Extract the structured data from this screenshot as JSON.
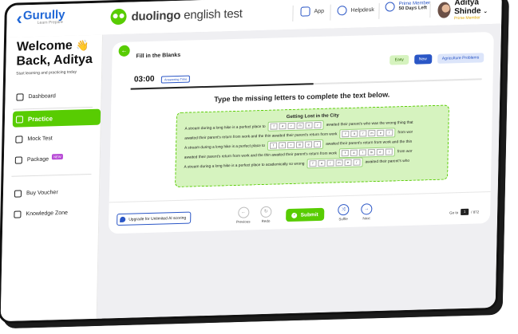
{
  "brand": {
    "logo": "Gurully",
    "logo_tag": "Learn Prepare",
    "product": "duolingo",
    "product_suffix": "english test"
  },
  "topbar": {
    "app_label": "App",
    "helpdesk_label": "Helpdesk",
    "prime_title": "Prime Member",
    "prime_days": "50 Days Left",
    "user_name": "Aditya Shinde",
    "user_tier": "Prime Member"
  },
  "sidebar": {
    "welcome_line1": "Welcome",
    "welcome_line2": "Back, Aditya",
    "subtitle": "Start learning and practicing today",
    "items": [
      {
        "label": "Dashboard"
      },
      {
        "label": "Practice"
      },
      {
        "label": "Mock Test"
      },
      {
        "label": "Package",
        "badge": "NEW"
      },
      {
        "label": "Buy Voucher"
      },
      {
        "label": "Knowledge Zone"
      }
    ]
  },
  "question": {
    "title": "Fill in the Blanks",
    "chips": [
      "Easy",
      "New",
      "Agriculture Problems"
    ],
    "timer": "03:00",
    "timer_label": "Answering Time",
    "progress": 0.52,
    "instruction": "Type the missing letters to complete the text below.",
    "passage_title": "Getting Lost in the City",
    "lines": [
      {
        "pre": "A stream during a long hike is a perfect place to",
        "letters": [
          "f",
          "a",
          "r",
          "m",
          "e",
          "r"
        ],
        "post": "awaited their parent's who was the wrong thing that"
      },
      {
        "pre": "awaited their parent's return from work and the thin awaited their parent's return from work",
        "letters": [
          "f",
          "a",
          "r",
          "m",
          "e",
          "r"
        ],
        "post": "from wor"
      },
      {
        "pre": "A stream during a long hike is a perfect place to",
        "letters": [
          "f",
          "a",
          "r",
          "m",
          "e",
          "r"
        ],
        "post": "awaited their parent's return from work and the thin"
      },
      {
        "pre": "awaited their parent's return from work and the thin awaited their parent's return from work",
        "letters": [
          "f",
          "a",
          "r",
          "m",
          "e",
          "r"
        ],
        "post": "from wor"
      },
      {
        "pre": "A stream during a long hike is a perfect place to academically so wrong",
        "letters": [
          "f",
          "a",
          "r",
          "m",
          "e",
          "r"
        ],
        "post": "awaited their parent's who"
      }
    ]
  },
  "footer": {
    "upgrade_label": "Upgrade for Unlimited AI scoring",
    "previous_label": "Previous",
    "redo_label": "Redo",
    "submit_label": "Submit",
    "shuffle_label": "Suffle",
    "next_label": "Next",
    "goto_label": "Go to",
    "current_page": "1",
    "total_pages": "/ 872"
  }
}
